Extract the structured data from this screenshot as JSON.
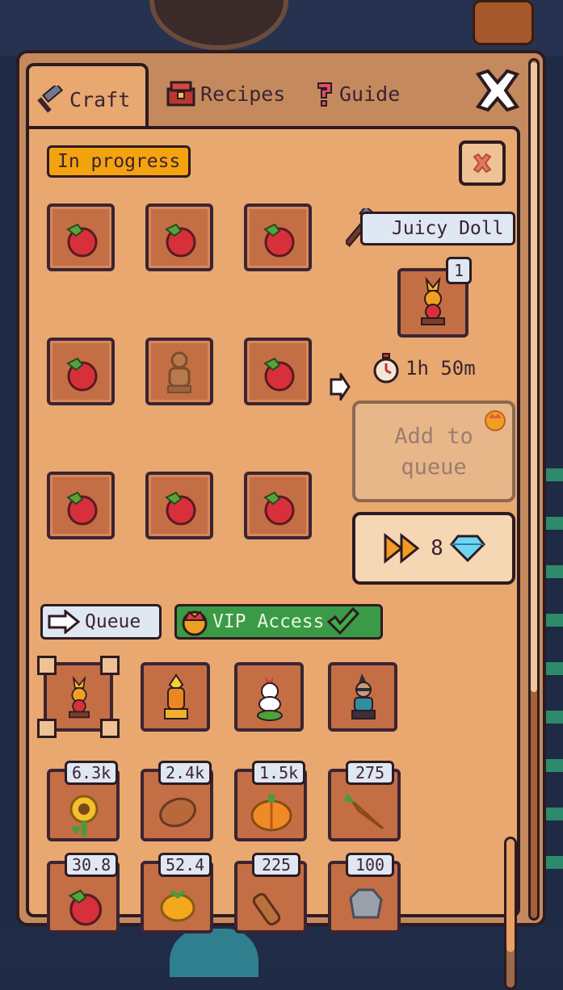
{
  "tabs": [
    {
      "label": "Craft",
      "icon": "hammer-icon",
      "active": true
    },
    {
      "label": "Recipes",
      "icon": "chest-icon",
      "active": false
    },
    {
      "label": "Guide",
      "icon": "question-icon",
      "active": false
    }
  ],
  "craft": {
    "status": "In progress",
    "recipe_name": "Juicy Doll",
    "result_qty": "1",
    "time_remaining": "1h 50m",
    "add_to_queue": "Add to queue",
    "speedup_cost": "8"
  },
  "ingredient_grid": [
    "tomato-icon",
    "tomato-icon",
    "tomato-icon",
    "tomato-icon",
    "doll-icon",
    "tomato-icon",
    "tomato-icon",
    "tomato-icon",
    "tomato-icon"
  ],
  "queue": {
    "label": "Queue",
    "vip_label": "VIP Access",
    "items": [
      "juicy-doll-icon",
      "fire-doll-icon",
      "chicken-doll-icon",
      "punk-doll-icon"
    ]
  },
  "inventory": [
    {
      "count": "6.3k",
      "icon": "sunflower-icon"
    },
    {
      "count": "2.4k",
      "icon": "potato-icon"
    },
    {
      "count": "1.5k",
      "icon": "pumpkin-icon"
    },
    {
      "count": "275",
      "icon": "carrot-icon"
    },
    {
      "count": "30.8",
      "icon": "tomato-icon"
    },
    {
      "count": "52.4",
      "icon": "orange-icon"
    },
    {
      "count": "225",
      "icon": "wood-icon"
    },
    {
      "count": "100",
      "icon": "stone-icon"
    }
  ],
  "colors": {
    "panel": "#e8a86f",
    "slot": "#c36e44",
    "status_badge": "#f4a310",
    "vip_green": "#3a9a45",
    "border": "#2d1b22"
  }
}
